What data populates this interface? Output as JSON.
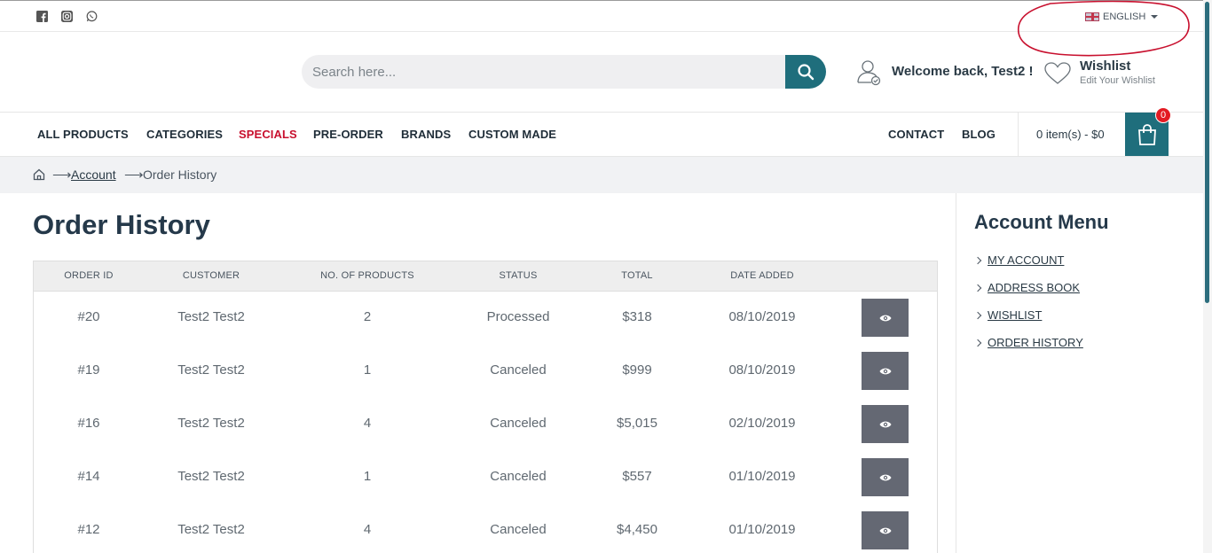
{
  "topbar": {
    "social_icons": [
      "facebook-icon",
      "instagram-icon",
      "whatsapp-icon"
    ],
    "language": "ENGLISH"
  },
  "header": {
    "search_placeholder": "Search here...",
    "welcome": "Welcome back, Test2 !",
    "wishlist_title": "Wishlist",
    "wishlist_sub": "Edit Your Wishlist"
  },
  "nav": {
    "left": [
      "ALL PRODUCTS",
      "CATEGORIES",
      "SPECIALS",
      "PRE-ORDER",
      "BRANDS",
      "CUSTOM MADE"
    ],
    "right": [
      "CONTACT",
      "BLOG"
    ],
    "cart_text": "0 item(s) - $0",
    "cart_count": "0"
  },
  "breadcrumb": {
    "link": "Account",
    "current": "Order History"
  },
  "page_title": "Order History",
  "table": {
    "headers": [
      "ORDER ID",
      "CUSTOMER",
      "NO. OF PRODUCTS",
      "STATUS",
      "TOTAL",
      "DATE ADDED"
    ],
    "rows": [
      {
        "id": "#20",
        "customer": "Test2 Test2",
        "products": "2",
        "status": "Processed",
        "total": "$318",
        "date": "08/10/2019"
      },
      {
        "id": "#19",
        "customer": "Test2 Test2",
        "products": "1",
        "status": "Canceled",
        "total": "$999",
        "date": "08/10/2019"
      },
      {
        "id": "#16",
        "customer": "Test2 Test2",
        "products": "4",
        "status": "Canceled",
        "total": "$5,015",
        "date": "02/10/2019"
      },
      {
        "id": "#14",
        "customer": "Test2 Test2",
        "products": "1",
        "status": "Canceled",
        "total": "$557",
        "date": "01/10/2019"
      },
      {
        "id": "#12",
        "customer": "Test2 Test2",
        "products": "4",
        "status": "Canceled",
        "total": "$4,450",
        "date": "01/10/2019"
      }
    ]
  },
  "account_menu": {
    "title": "Account Menu",
    "items": [
      "MY ACCOUNT",
      "ADDRESS BOOK",
      "WISHLIST",
      "ORDER HISTORY"
    ]
  },
  "colors": {
    "accent": "#1f6e7c",
    "special": "#c8102e",
    "badge": "#e31b23",
    "annotation": "#c8102e"
  }
}
